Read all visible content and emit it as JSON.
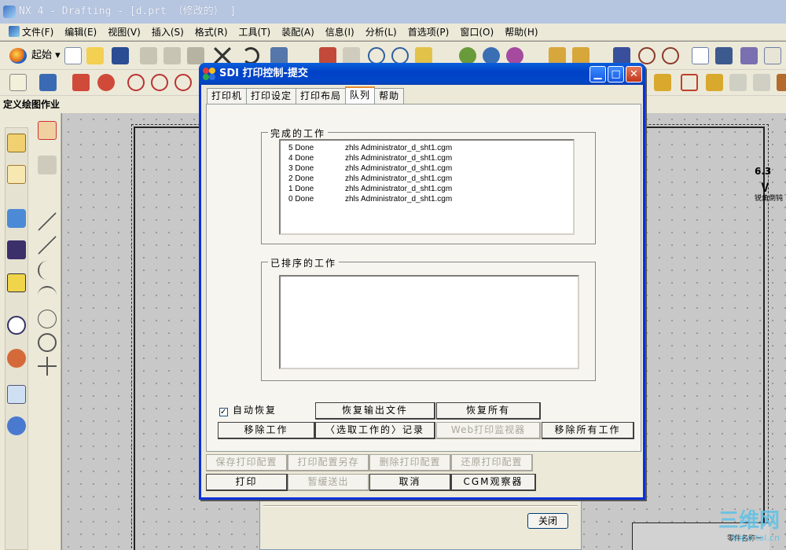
{
  "app": {
    "title": "NX 4 - Drafting - [d.prt （修改的） ]"
  },
  "menu": {
    "items": [
      "文件(F)",
      "编辑(E)",
      "视图(V)",
      "插入(S)",
      "格式(R)",
      "工具(T)",
      "装配(A)",
      "信息(I)",
      "分析(L)",
      "首选项(P)",
      "窗口(O)",
      "帮助(H)"
    ]
  },
  "toolbar": {
    "start_label": "起始"
  },
  "task": {
    "header": "定义绘图作业"
  },
  "drawing": {
    "symbol_value": "6.3",
    "symbol_label": "锐角倒钝",
    "titleblock_text": "零件名称一"
  },
  "watermark": {
    "main": "三维网",
    "sub": "3dportal.cn"
  },
  "dialog": {
    "title": "SDI 打印控制-提交",
    "tabs": [
      "打印机",
      "打印设定",
      "打印布局",
      "队列",
      "帮助"
    ],
    "active_tab": "队列",
    "completed_label": "完成的工作",
    "completed_jobs": [
      {
        "id": "5 Done",
        "desc": "zhls Administrator_d_sht1.cgm"
      },
      {
        "id": "4 Done",
        "desc": "zhls Administrator_d_sht1.cgm"
      },
      {
        "id": "3 Done",
        "desc": "zhls Administrator_d_sht1.cgm"
      },
      {
        "id": "2 Done",
        "desc": "zhls Administrator_d_sht1.cgm"
      },
      {
        "id": "1 Done",
        "desc": "zhls Administrator_d_sht1.cgm"
      },
      {
        "id": "0 Done",
        "desc": "zhls Administrator_d_sht1.cgm"
      }
    ],
    "queued_label": "已排序的工作",
    "auto_recover_label": "自动恢复",
    "auto_recover_checked": true,
    "btn_recover_output": "恢复输出文件",
    "btn_recover_all": "恢复所有",
    "btn_remove_job": "移除工作",
    "btn_selected_log": "〈选取工作的〉记录",
    "btn_web_monitor": "Web打印监视器",
    "btn_remove_all": "移除所有工作",
    "btn_save_config": "保存打印配置",
    "btn_save_config_as": "打印配置另存",
    "btn_delete_config": "删除打印配置",
    "btn_restore_config": "还原打印配置",
    "btn_print": "打印",
    "btn_defer": "暂缓送出",
    "btn_cancel": "取消",
    "btn_cgm_viewer": "CGM观察器"
  },
  "back_dialog": {
    "close_label": "关闭"
  },
  "colors": {
    "title_blue": "#0042c8",
    "window_face": "#ece9d8",
    "canvas_gray": "#c8c8c8"
  }
}
